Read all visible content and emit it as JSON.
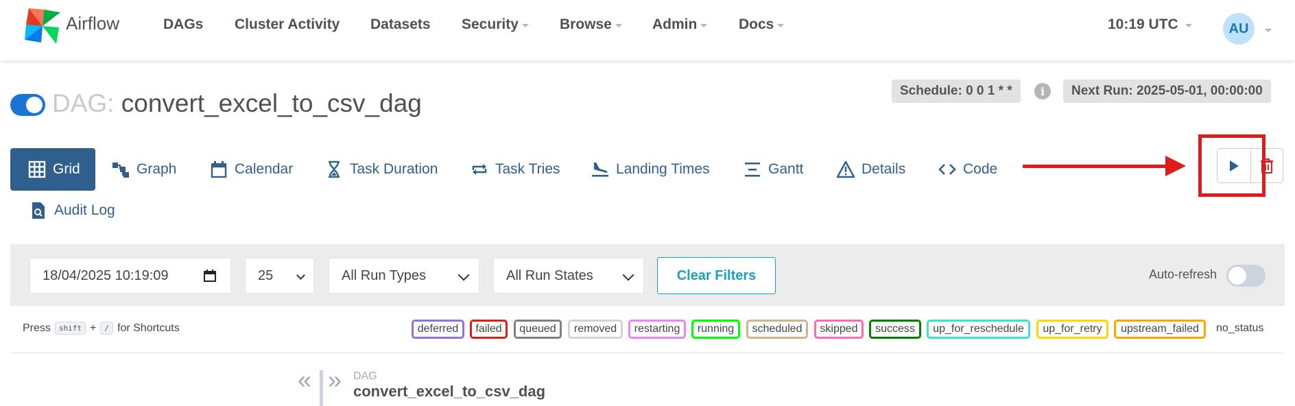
{
  "navbar": {
    "brand": "Airflow",
    "items": [
      {
        "label": "DAGs",
        "dropdown": false
      },
      {
        "label": "Cluster Activity",
        "dropdown": false
      },
      {
        "label": "Datasets",
        "dropdown": false
      },
      {
        "label": "Security",
        "dropdown": true
      },
      {
        "label": "Browse",
        "dropdown": true
      },
      {
        "label": "Admin",
        "dropdown": true
      },
      {
        "label": "Docs",
        "dropdown": true
      }
    ],
    "clock": "10:19 UTC",
    "user_initials": "AU"
  },
  "dag": {
    "prefix": "DAG:",
    "name": "convert_excel_to_csv_dag",
    "schedule": "Schedule: 0 0 1 * *",
    "info_icon": "i",
    "next_run": "Next Run: 2025-05-01, 00:00:00"
  },
  "tabs": [
    {
      "label": "Grid",
      "icon": "grid-icon",
      "active": true
    },
    {
      "label": "Graph",
      "icon": "graph-icon"
    },
    {
      "label": "Calendar",
      "icon": "calendar-icon"
    },
    {
      "label": "Task Duration",
      "icon": "hourglass-icon"
    },
    {
      "label": "Task Tries",
      "icon": "repeat-icon"
    },
    {
      "label": "Landing Times",
      "icon": "plane-landing-icon"
    },
    {
      "label": "Gantt",
      "icon": "gantt-icon"
    },
    {
      "label": "Details",
      "icon": "warning-triangle-icon"
    },
    {
      "label": "Code",
      "icon": "code-icon"
    },
    {
      "label": "Audit Log",
      "icon": "file-search-icon"
    }
  ],
  "actions": {
    "trigger": "play-icon",
    "delete": "trash-icon"
  },
  "filters": {
    "date": "18/04/2025  10:19:09",
    "num_runs": "25",
    "run_types": "All Run Types",
    "run_states": "All Run States",
    "clear_label": "Clear Filters",
    "auto_refresh_label": "Auto-refresh",
    "auto_refresh_on": false
  },
  "shortcuts": {
    "press": "Press",
    "key1": "shift",
    "plus": "+",
    "key2": "/",
    "suffix": "for Shortcuts"
  },
  "states": [
    {
      "label": "deferred",
      "color": "#9370db"
    },
    {
      "label": "failed",
      "color": "#e01b1b"
    },
    {
      "label": "queued",
      "color": "#808080"
    },
    {
      "label": "removed",
      "color": "#d3d3d3"
    },
    {
      "label": "restarting",
      "color": "#ee82ee"
    },
    {
      "label": "running",
      "color": "#00ff00"
    },
    {
      "label": "scheduled",
      "color": "#d2b48c"
    },
    {
      "label": "skipped",
      "color": "#ff69b4"
    },
    {
      "label": "success",
      "color": "#008000"
    },
    {
      "label": "up_for_reschedule",
      "color": "#40e0d0"
    },
    {
      "label": "up_for_retry",
      "color": "#ffd700"
    },
    {
      "label": "upstream_failed",
      "color": "#ffa500"
    }
  ],
  "no_status": "no_status",
  "grid_header": {
    "small": "DAG",
    "name": "convert_excel_to_csv_dag",
    "collapse": "«",
    "expand": "»"
  },
  "annotation": {
    "color": "#e01b1b"
  }
}
